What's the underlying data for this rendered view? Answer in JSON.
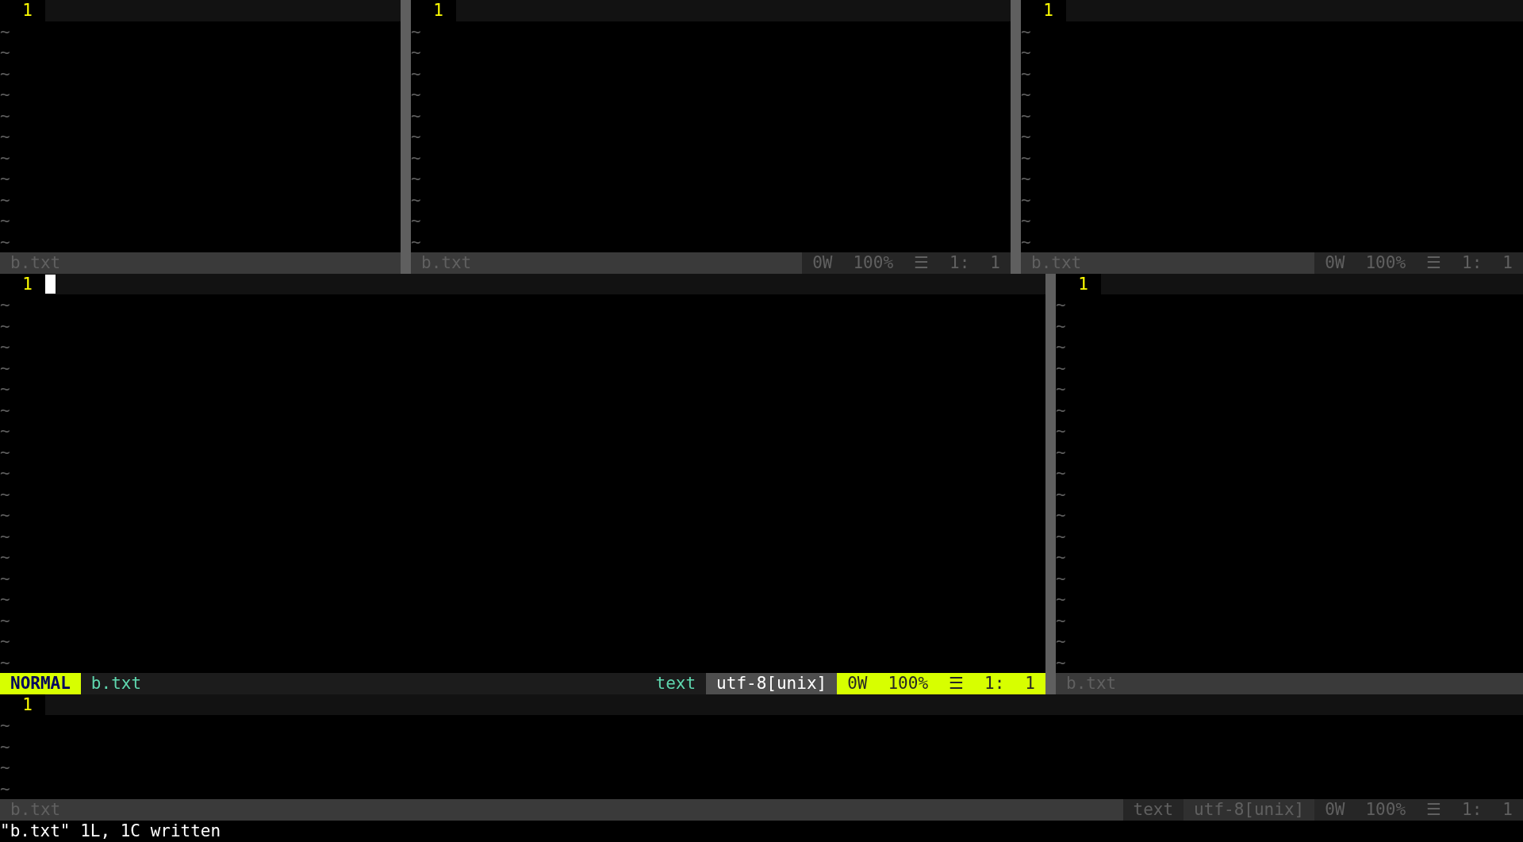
{
  "rows": [
    {
      "panes": [
        {
          "active": false,
          "line_number": "1",
          "tildes": [
            "~",
            "~",
            "~",
            "~",
            "~",
            "~",
            "~",
            "~",
            "~",
            "~",
            "~"
          ],
          "status": {
            "file": "b.txt"
          }
        },
        {
          "active": false,
          "line_number": "1",
          "tildes": [
            "~",
            "~",
            "~",
            "~",
            "~",
            "~",
            "~",
            "~",
            "~",
            "~",
            "~"
          ],
          "status": {
            "file": "b.txt",
            "segments": [
              {
                "kind": "position",
                "text": "0W"
              },
              {
                "kind": "position",
                "text": "100%"
              },
              {
                "kind": "position",
                "text": "☰"
              },
              {
                "kind": "position",
                "text": "1:"
              },
              {
                "kind": "position",
                "text": "1"
              }
            ]
          }
        },
        {
          "active": false,
          "line_number": "1",
          "tildes": [
            "~",
            "~",
            "~",
            "~",
            "~",
            "~",
            "~",
            "~",
            "~",
            "~",
            "~"
          ],
          "status": {
            "file": "b.txt",
            "segments": [
              {
                "kind": "position",
                "text": "0W"
              },
              {
                "kind": "position",
                "text": "100%"
              },
              {
                "kind": "position",
                "text": "☰"
              },
              {
                "kind": "position",
                "text": "1:"
              },
              {
                "kind": "position",
                "text": "1"
              }
            ]
          }
        }
      ]
    },
    {
      "panes": [
        {
          "active": true,
          "line_number": "1",
          "tildes": [
            "~",
            "~",
            "~",
            "~",
            "~",
            "~",
            "~",
            "~",
            "~",
            "~",
            "~",
            "~",
            "~",
            "~",
            "~",
            "~",
            "~",
            "~"
          ],
          "status": {
            "mode": "NORMAL",
            "file": "b.txt",
            "segments": [
              {
                "kind": "filetype",
                "text": "text"
              },
              {
                "kind": "encoding",
                "text": "utf-8[unix]"
              },
              {
                "kind": "position",
                "text": "0W"
              },
              {
                "kind": "position",
                "text": "100%"
              },
              {
                "kind": "position",
                "text": "☰"
              },
              {
                "kind": "position",
                "text": "1:"
              },
              {
                "kind": "position",
                "text": "1"
              }
            ]
          }
        },
        {
          "active": false,
          "line_number": "1",
          "tildes": [
            "~",
            "~",
            "~",
            "~",
            "~",
            "~",
            "~",
            "~",
            "~",
            "~",
            "~",
            "~",
            "~",
            "~",
            "~",
            "~",
            "~",
            "~"
          ],
          "status": {
            "file": "b.txt"
          }
        }
      ]
    },
    {
      "panes": [
        {
          "active": false,
          "line_number": "1",
          "tildes": [
            "~",
            "~",
            "~",
            "~"
          ],
          "status": {
            "file": "b.txt",
            "segments": [
              {
                "kind": "filetype",
                "text": "text"
              },
              {
                "kind": "encoding",
                "text": "utf-8[unix]"
              },
              {
                "kind": "position",
                "text": "0W"
              },
              {
                "kind": "position",
                "text": "100%"
              },
              {
                "kind": "position",
                "text": "☰"
              },
              {
                "kind": "position",
                "text": "1:"
              },
              {
                "kind": "position",
                "text": "1"
              }
            ]
          }
        }
      ]
    }
  ],
  "message": "\"b.txt\" 1L, 1C written"
}
